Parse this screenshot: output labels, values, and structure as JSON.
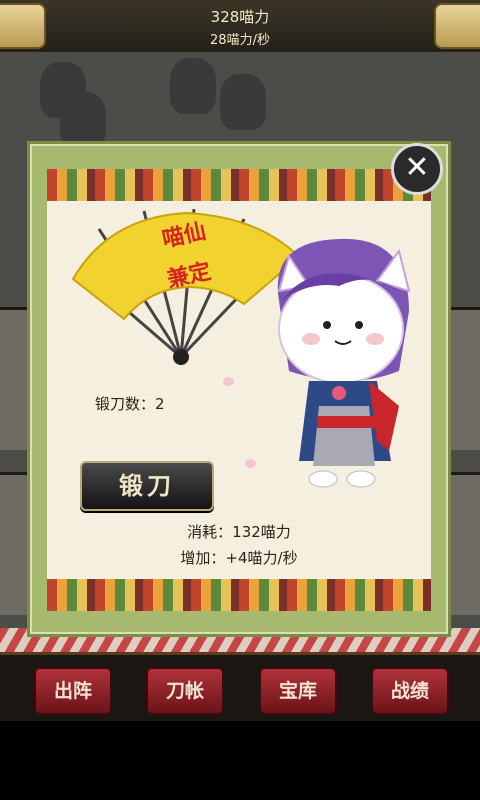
{
  "header": {
    "currency_total": "328喵力",
    "currency_rate": "28喵力/秒"
  },
  "dialog": {
    "fan_text": "喵仙\n兼定",
    "forge_count_label": "锻刀数：2",
    "forge_button_label": "锻刀",
    "cost_label": "消耗：132喵力",
    "gain_label": "增加：+4喵力/秒",
    "close_icon": "close-icon"
  },
  "nav": {
    "tabs": [
      {
        "label": "出阵"
      },
      {
        "label": "刀帐"
      },
      {
        "label": "宝库"
      },
      {
        "label": "战绩"
      }
    ]
  },
  "colors": {
    "accent_red": "#b0323a",
    "dialog_frame": "#a7b86f",
    "panel_bg": "#f4efde",
    "fan_gold": "#f2d22e"
  }
}
